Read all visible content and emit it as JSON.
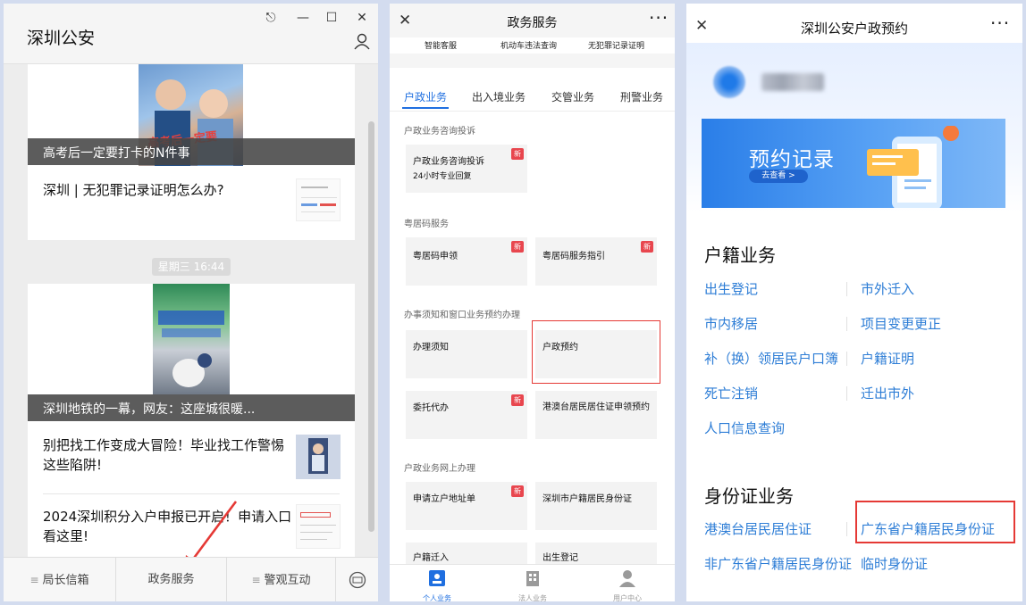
{
  "accent_blue": "#1f6fe0",
  "highlight_red": "#e53935",
  "panel1": {
    "title": "深圳公安",
    "articles": [
      {
        "caption": "高考后一定要打卡的N件事",
        "cover_text": "高考后一定要",
        "title": "深圳 | 无犯罪记录证明怎么办?"
      },
      {
        "timestamp": "星期三 16:44"
      },
      {
        "caption": "深圳地铁的一幕，网友：这座城很暖...",
        "title": "别把找工作变成大冒险！毕业找工作警惕这些陷阱!"
      },
      {
        "title": "2024深圳积分入户申报已开启！申请入口看这里!"
      }
    ],
    "menu": [
      {
        "label": "局长信箱"
      },
      {
        "label": "政务服务"
      },
      {
        "label": "警观互动"
      }
    ]
  },
  "panel2": {
    "title": "政务服务",
    "quick": [
      "智能客服",
      "机动车违法查询",
      "无犯罪记录证明"
    ],
    "tabs": [
      "户政业务",
      "出入境业务",
      "交管业务",
      "刑警业务"
    ],
    "sections": [
      {
        "label": "户政业务咨询投诉",
        "items": [
          {
            "title": "户政业务咨询投诉",
            "subtitle": "24小时专业回复",
            "badge": "新"
          }
        ]
      },
      {
        "label": "粤居码服务",
        "items": [
          {
            "title": "粤居码申领",
            "badge": "新"
          },
          {
            "title": "粤居码服务指引",
            "badge": "新"
          }
        ]
      },
      {
        "label": "办事须知和窗口业务预约办理",
        "items": [
          {
            "title": "办理须知"
          },
          {
            "title": "户政预约"
          },
          {
            "title": "委托代办",
            "badge": "新"
          },
          {
            "title": "港澳台居民居住证申领预约"
          }
        ]
      },
      {
        "label": "户政业务网上办理",
        "items": [
          {
            "title": "申请立户地址单",
            "badge": "新"
          },
          {
            "title": "深圳市户籍居民身份证"
          },
          {
            "title": "户籍迁入"
          },
          {
            "title": "出生登记"
          }
        ]
      }
    ],
    "nav": [
      "个人业务",
      "法人业务",
      "用户中心"
    ]
  },
  "panel3": {
    "title": "深圳公安户政预约",
    "banner": {
      "title": "预约记录",
      "button": "去查看 >"
    },
    "huji": {
      "heading": "户籍业务",
      "links": [
        "出生登记",
        "市外迁入",
        "市内移居",
        "项目变更更正",
        "补（换）领居民户口簿",
        "户籍证明",
        "死亡注销",
        "迁出市外",
        "人口信息查询"
      ]
    },
    "id": {
      "heading": "身份证业务",
      "links": [
        "港澳台居民居住证",
        "广东省户籍居民身份证",
        "非广东省户籍居民身份证",
        "临时身份证"
      ]
    }
  }
}
